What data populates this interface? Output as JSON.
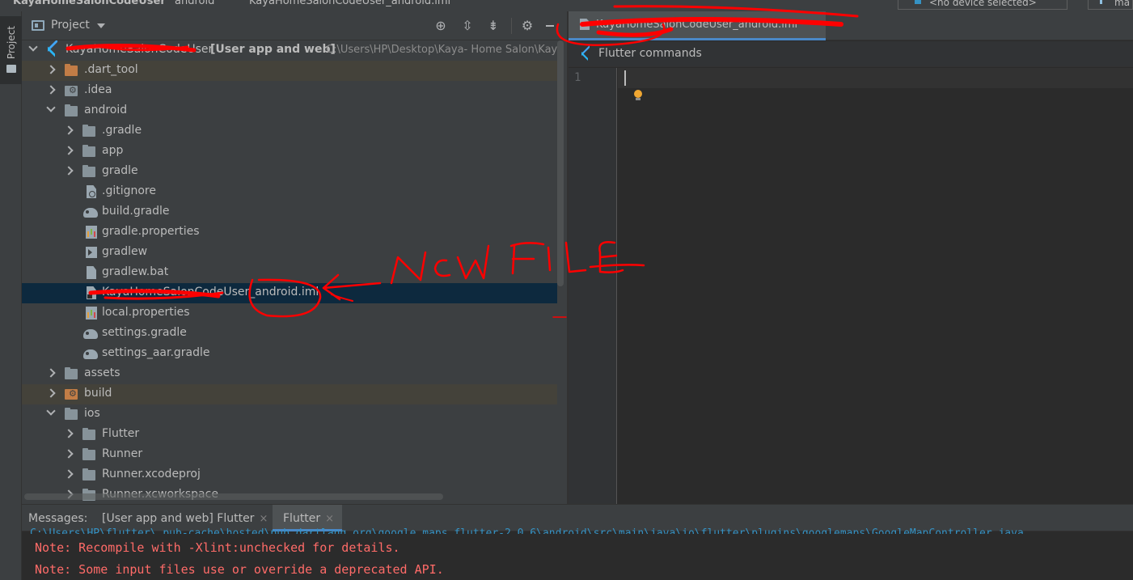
{
  "topbar": {
    "crumb_project": "KayaHomeSalonCodeUser",
    "crumb_android": "android",
    "crumb_file": "KayaHomeSalonCodeUser_android.iml",
    "device": "<no device selected>",
    "run_tail": "ma"
  },
  "toolstrip": {
    "label": "Project"
  },
  "panel": {
    "title": "Project",
    "header_buttons": [
      "locate-icon",
      "expand-all-icon",
      "collapse-all-icon",
      "gear-icon",
      "hide-icon"
    ]
  },
  "tree": {
    "root_name": "KayaHomeSalonCodeUser",
    "root_module": "[User app and web]",
    "root_path": "C:\\Users\\HP\\Desktop\\Kaya- Home Salon\\Kay",
    "items": [
      {
        "label": ".dart_tool"
      },
      {
        "label": ".idea"
      },
      {
        "label": "android"
      },
      {
        "label": ".gradle"
      },
      {
        "label": "app"
      },
      {
        "label": "gradle"
      },
      {
        "label": ".gitignore"
      },
      {
        "label": "build.gradle"
      },
      {
        "label": "gradle.properties"
      },
      {
        "label": "gradlew"
      },
      {
        "label": "gradlew.bat"
      },
      {
        "label": "KayaHomeSalonCodeUser_android.iml"
      },
      {
        "label": "local.properties"
      },
      {
        "label": "settings.gradle"
      },
      {
        "label": "settings_aar.gradle"
      },
      {
        "label": "assets"
      },
      {
        "label": "build"
      },
      {
        "label": "ios"
      },
      {
        "label": "Flutter"
      },
      {
        "label": "Runner"
      },
      {
        "label": "Runner.xcodeproj"
      },
      {
        "label": "Runner.xcworkspace"
      }
    ]
  },
  "editor": {
    "tab_label": "KayaHomeSalonCodeUser_android.iml",
    "flutter_commands": "Flutter commands",
    "line_number": "1"
  },
  "messages": {
    "label": "Messages:",
    "tab1": "[User app and web] Flutter",
    "tab2": "Flutter",
    "close": "×",
    "lines": [
      "Note: Recompile with -Xlint:unchecked for details.",
      "Note: Some input files use or override a deprecated API."
    ]
  },
  "annotation": {
    "text": "New FiLE"
  },
  "colors": {
    "accent": "#4a88c7",
    "selection": "#0d293e",
    "excluded_row": "#44423a",
    "error_text": "#ff6b68",
    "annotation_red": "#ff0000"
  }
}
